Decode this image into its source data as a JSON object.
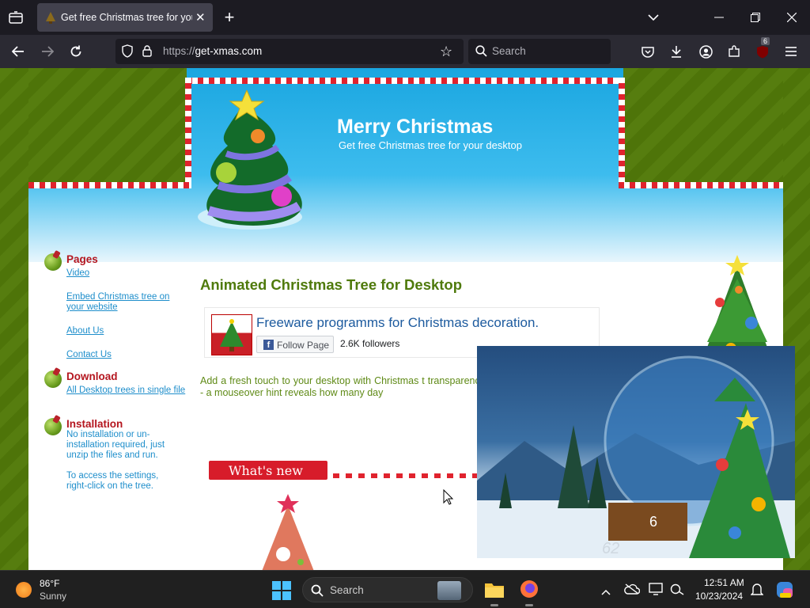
{
  "browser": {
    "tab_title": "Get free Christmas tree for your desktop",
    "url_scheme": "https://",
    "url_host": "get-xmas.com",
    "search_placeholder": "Search",
    "extension_badge": "6"
  },
  "site": {
    "title": "Merry Christmas",
    "subtitle": "Get free Christmas tree for your desktop",
    "sidebar": [
      {
        "title": "Pages",
        "links": [
          "Video",
          "Embed Christmas tree on your website",
          "About Us",
          "Contact Us"
        ]
      },
      {
        "title": "Download",
        "links": [
          "All Desktop trees in single file"
        ]
      },
      {
        "title": "Installation",
        "text": [
          "No installation or un-installation required, just unzip the files and run.",
          "To access the settings, right-click on the tree."
        ]
      }
    ],
    "main_heading": "Animated Christmas Tree for Desktop",
    "facebook": {
      "page_name": "Freeware programms for Christmas decoration.",
      "follow_label": "Follow Page",
      "followers": "2.6K followers"
    },
    "intro_text": "Add a fresh touch to your desktop with Christmas t transparency - a mouseover hint reveals how many day",
    "whats_new_label": "What's new",
    "snow_globe_number": "62",
    "snow_globe_counter": "6"
  },
  "taskbar": {
    "weather_temp": "86°F",
    "weather_desc": "Sunny",
    "search_label": "Search",
    "time": "12:51 AM",
    "date": "10/23/2024"
  },
  "colors": {
    "accent_green": "#4f7a0c",
    "accent_red": "#b4151e",
    "link_blue": "#1e8ecb",
    "browser_dark": "#1c1b22"
  }
}
